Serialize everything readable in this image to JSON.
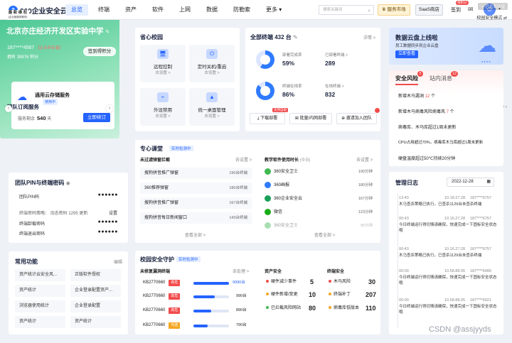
{
  "topbar": {
    "logo_mark": "3",
    "logo_text": "360企业安全云",
    "nav": [
      "总览",
      "终端",
      "资产",
      "软件",
      "上网",
      "数据",
      "防勒索",
      "更多"
    ],
    "search_placeholder": "搜索关键词",
    "market": "服务市场",
    "saas": "SaaS商店",
    "signin": "签到",
    "signin_badge": "领积分",
    "mail_icon": "mail-icon",
    "avatar_icon": "user-icon"
  },
  "org": {
    "tag_line1": "最 新 维 权",
    "tag_line2": "(企业版服务期内)",
    "certified": "已企业认证",
    "mode": "校园安全模式",
    "name": "北京亦庄经济开发区实验中学",
    "phone": "187****4567",
    "role": "【企业所有者】",
    "points_label": "拥有",
    "points": "39876",
    "points_unit": "积分",
    "sign_button": "签到得积分",
    "subs_title": "团队订阅服务",
    "subs_more": "更多",
    "service_name": "通用云存储服务",
    "service_status": "使用中",
    "days_label": "服务剩余",
    "days": "540",
    "days_unit": "天",
    "renew": "立即续订"
  },
  "pin": {
    "title": "团队PIN与终端密码",
    "rows": [
      {
        "label": "团队PIN码",
        "value": "●●●●●●"
      },
      {
        "label": "终端密码策略： 动态密码 1295 更新",
        "value": "设置"
      },
      {
        "label": "终端卸载密码",
        "value": "●●●●●●"
      },
      {
        "label": "终端退出密码",
        "value": "●●●●●●"
      }
    ]
  },
  "common": {
    "title": "常用功能",
    "edit": "编辑",
    "items": [
      "资产统计云安全风...",
      "正版软件授权",
      "资产统计",
      "企业登录配置资产...",
      "浏览器使用统计",
      "企业登录配置",
      "资产统计",
      "资产统计"
    ]
  },
  "worry": {
    "title": "省心校园",
    "items": [
      {
        "title": "远程控制",
        "sub": "去设置 >"
      },
      {
        "title": "定时关机/重启",
        "sub": "去设置 >"
      },
      {
        "title": "外设禁用",
        "sub": "去设置 >"
      },
      {
        "title": "统一桌面管理",
        "sub": "去设置 >"
      }
    ]
  },
  "term": {
    "title": "全部终端 432 台",
    "more": "详情 >",
    "rows": [
      {
        "label1": "部署完成率",
        "value1": "59%",
        "label2": "已部署终端 >",
        "value2": "289"
      },
      {
        "label1": "终端在线率",
        "value1": "86%",
        "label2": "在线终端 >",
        "value2": "832"
      }
    ],
    "buttons": [
      "下载部署",
      "批量/内网部署",
      "邀请加入团队"
    ],
    "button_badge": "支持自助"
  },
  "banner": {
    "title": "数据云盘上线啦",
    "sub": "员工数据同步到企业云盘",
    "button": "立即查看"
  },
  "risk": {
    "tab1": "安全风险",
    "tab1_count": "5",
    "tab2": "站内消息",
    "tab2_count": "12",
    "items": [
      {
        "text": "新增木马漏洞",
        "num": "12",
        "tail": "个"
      },
      {
        "text": "新增木马病毒风险病毒风",
        "num": "7",
        "tail": "个"
      },
      {
        "text": "病毒库、木马库超过1周未更新",
        "num": "",
        "tail": ""
      },
      {
        "text": "CPU占用超过70%，病毒库木马库超过1周未更新",
        "num": "",
        "tail": ""
      },
      {
        "text": "硬盘温度超过50℃持续20分钟",
        "num": "",
        "tail": ""
      }
    ]
  },
  "course": {
    "title": "专心课堂",
    "live": "实时检测中",
    "left_title": "未过滤弹窗拦截",
    "left_more": "去设置 >",
    "left_rows": [
      {
        "name": "搜狗拼音推广弹窗",
        "count": "190台终端"
      },
      {
        "name": "360推荐弹窗",
        "count": "180台终端"
      },
      {
        "name": "搜狗拼音推广弹窗",
        "count": "167台终端"
      },
      {
        "name": "搜狗拼音每日新闻窗口",
        "count": "143台终端"
      }
    ],
    "left_view": "查看全部 >",
    "right_title": "教学软件使用时长",
    "right_sub": "(今日)",
    "right_more": "去设置 >",
    "right_rows": [
      {
        "name": "360安全卫士",
        "count": "190分钟",
        "color": "#3fb950"
      },
      {
        "name": "360画报",
        "count": "180分钟",
        "color": "#2f7bff"
      },
      {
        "name": "360企业安全云",
        "count": "167分钟",
        "color": "#18a058"
      },
      {
        "name": "微信",
        "count": "123分钟",
        "color": "#1aad19"
      },
      {
        "name": "360安全卫士",
        "count": "90分钟",
        "color": "#3fb950"
      }
    ],
    "right_view": "查看全部 >"
  },
  "guard": {
    "title": "校园安全守护",
    "live": "实时检测中",
    "left_title": "未修复漏洞终端",
    "left_more": "去处理 >",
    "left_rows": [
      {
        "id": "KB2770660",
        "level": "高危",
        "level_color": "#f24b4b",
        "value": "9990台",
        "pct": 1.0
      },
      {
        "id": "KB2770660",
        "level": "高危",
        "level_color": "#f24b4b",
        "value": "990台",
        "pct": 0.6
      },
      {
        "id": "KB2770660",
        "level": "高危",
        "level_color": "#f24b4b",
        "value": "890台",
        "pct": 0.5
      },
      {
        "id": "KB2770660",
        "level": "可选",
        "level_color": "#f5a623",
        "value": "790台",
        "pct": 0.4
      }
    ],
    "mid_title": "资产安全",
    "mid_rows": [
      {
        "name": "硬件减少事件",
        "value": "5",
        "dot": "#f24b4b"
      },
      {
        "name": "硬件新增/变更",
        "value": "10",
        "dot": "#f5a623"
      },
      {
        "name": "已拦截风险网站",
        "value": "80",
        "dot": "#3fb950"
      }
    ],
    "right_title": "终端安全",
    "right_rows": [
      {
        "name": "木马风险",
        "value": "30",
        "dot": "#f24b4b"
      },
      {
        "name": "终端补丁",
        "value": "207",
        "dot": "#f5a623"
      },
      {
        "name": "病毒库低版本",
        "value": "110",
        "dot": "#f5a623"
      }
    ]
  },
  "log": {
    "title": "管理日志",
    "date": "2022-12-28",
    "entries": [
      {
        "time": "13:43",
        "date": "10.18.27.28",
        "user": "187****6757",
        "msg": "木马查杀策略已执行，已查杀1129台未查杀终端"
      },
      {
        "time": "00:43",
        "date": "10.16.27.28",
        "user": "187****6757",
        "msg": "今日终端运行得切情请确保，快速完成一下固标安全状态哦"
      },
      {
        "time": "00:43",
        "date": "10.16.27.28",
        "user": "187****6757",
        "msg": "木马查杀策略已执行，已查杀1129台未查杀终端"
      },
      {
        "time": "00:00",
        "date": "10.58.88.05",
        "user": "187****6480",
        "msg": "今日终端运行得切情请确保，快速完成一下固标安全状态哦"
      },
      {
        "time": "00:00",
        "date": "10.58.88.05",
        "user": "187****6921",
        "msg": "今日终端运行得切情请确保，快速完成一下固标安全状态哦"
      }
    ]
  },
  "watermark": "CSDN @assjyyds"
}
